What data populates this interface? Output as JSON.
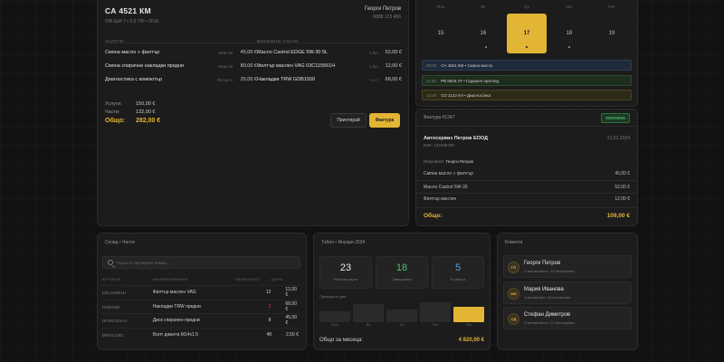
{
  "order": {
    "plate": "СА 4521 КМ",
    "car": "VW Golf 7 • 2.0 TDI • 2016",
    "owner_name": "Георги Петров",
    "owner_phone": "0888 123 456",
    "services_header": "Услуги",
    "parts_header": "Вложени части",
    "services": [
      {
        "name": "Смяна масло + филтър",
        "worker": "Иван М.",
        "price": "45,00 €"
      },
      {
        "name": "Смяна спирачни накладки предни",
        "worker": "Иван М.",
        "price": "80,00 €"
      },
      {
        "name": "Диагностика с компютър",
        "worker": "Петър К.",
        "price": "25,00 €"
      }
    ],
    "parts": [
      {
        "name": "Масло Castrol EDGE 5W-30 5L",
        "qty": "1 бр.",
        "price": "52,00 €"
      },
      {
        "name": "Филтър маслен VAG 03C115561H",
        "qty": "1 бр.",
        "price": "12,00 €"
      },
      {
        "name": "Накладки TRW GDB1550",
        "qty": "1 к-т",
        "price": "68,00 €"
      }
    ],
    "totals": {
      "services_label": "Услуги:",
      "services_value": "150,00 €",
      "parts_label": "Части:",
      "parts_value": "132,00 €",
      "sum_label": "Общо:",
      "sum_value": "282,00 €"
    },
    "print_label": "Принтирай",
    "invoice_label": "Фактура"
  },
  "calendar": {
    "days": [
      {
        "name": "Пон",
        "num": "15",
        "dot": false
      },
      {
        "name": "Вт",
        "num": "16",
        "dot": true
      },
      {
        "name": "Ср",
        "num": "17",
        "dot": true,
        "active": true
      },
      {
        "name": "Чет",
        "num": "18",
        "dot": true
      },
      {
        "name": "Пет",
        "num": "19",
        "dot": false
      }
    ],
    "appointments": [
      {
        "time": "09:00",
        "text": "СА 4521 КМ • Смяна масло",
        "color": "#1f2a3a",
        "border": "#2d3d55"
      },
      {
        "time": "11:30",
        "text": "РВ 8834 АТ • Годишен преглед",
        "color": "#1e2e1e",
        "border": "#2e4a2e"
      },
      {
        "time": "14:00",
        "text": "СО 1122 КН • Диагностика",
        "color": "#2e2a18",
        "border": "#4a4222"
      }
    ]
  },
  "invoice": {
    "title": "Фактура #1247",
    "status": "ПЛАТЕНА",
    "company": "Автосервиз Петров ЕООД",
    "eik": "ЕИК: 123456789",
    "date": "21.01.2024",
    "recipient_label": "Получател:",
    "recipient": "Георги Петров",
    "lines": [
      {
        "name": "Смяна масло + филтър",
        "price": "45,00 €"
      },
      {
        "name": "Масло Castrol 5W-30",
        "price": "52,00 €"
      },
      {
        "name": "Филтър маслен",
        "price": "12,00 €"
      }
    ],
    "total_label": "Общо:",
    "total_value": "109,00 €"
  },
  "warehouse": {
    "title": "Склад • Части",
    "search_placeholder": "Търси по артикулен номер...",
    "headers": {
      "article": "Артикул",
      "name": "Наименование",
      "qty": "Наличност",
      "price": "Цена"
    },
    "rows": [
      {
        "article": "03C115561H",
        "name": "Филтър маслен VAG",
        "qty": "12",
        "price": "12,00 €",
        "low": false
      },
      {
        "article": "GDB1550",
        "name": "Накладки TRW предни",
        "qty": "2",
        "price": "68,00 €",
        "low": true
      },
      {
        "article": "DF4823S1AA",
        "name": "Диск спирачен предни",
        "qty": "8",
        "price": "45,00 €",
        "low": false
      },
      {
        "article": "B90013382",
        "name": "Болт джанта M14x1.5",
        "qty": "48",
        "price": "2,50 €",
        "low": false
      }
    ]
  },
  "board": {
    "title": "Табло • Януари 2024",
    "stats": [
      {
        "value": "23",
        "label": "Работни карти",
        "color": "#e6e6e6"
      },
      {
        "value": "18",
        "label": "Завършени",
        "color": "#4ec26a"
      },
      {
        "value": "5",
        "label": "В работа",
        "color": "#4ea6e6"
      }
    ],
    "revenue_label": "Приходи по дни",
    "bars": [
      {
        "day": "Пон",
        "level": 0.45,
        "hi": false
      },
      {
        "day": "Вт",
        "level": 0.75,
        "hi": false
      },
      {
        "day": "Ср",
        "level": 0.55,
        "hi": false
      },
      {
        "day": "Чет",
        "level": 0.85,
        "hi": false
      },
      {
        "day": "Пет",
        "level": 0.65,
        "hi": true
      }
    ],
    "month_label": "Общо за месеца:",
    "month_value": "4 820,00 €"
  },
  "clients": {
    "title": "Клиенти",
    "items": [
      {
        "initials": "ГП",
        "name": "Георги Петров",
        "sub": "2 автомобила • 15 посещения"
      },
      {
        "initials": "МИ",
        "name": "Мария Иванова",
        "sub": "1 автомобил • 8 посещения"
      },
      {
        "initials": "СД",
        "name": "Стефан Димитров",
        "sub": "3 автомобила • 22 посещения"
      }
    ]
  }
}
